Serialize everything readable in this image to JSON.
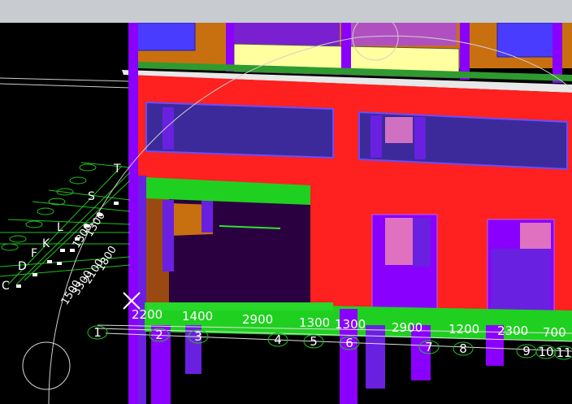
{
  "window": {
    "title": ""
  },
  "viewport": {
    "grid_letters": [
      "T",
      "S",
      "L",
      "K",
      "F",
      "D",
      "C"
    ],
    "grid_numbers": [
      "1",
      "2",
      "3",
      "4",
      "5",
      "6",
      "7",
      "8",
      "9",
      "10",
      "11"
    ],
    "dimensions_front": [
      "2200",
      "1400",
      "2900",
      "1300",
      "1300",
      "2900",
      "1200",
      "2300",
      "700"
    ],
    "dimensions_side_left": [
      "1500",
      "3300",
      "2100",
      "1800"
    ],
    "dimensions_side_right": [
      "1300",
      "1300"
    ],
    "colors": {
      "slab_red": "#ff2020",
      "column_purple": "#8a00ff",
      "window_blue": "#3c2a9a",
      "beam_green": "#20d020",
      "wall_orange": "#c87010",
      "grid_line": "#20c020"
    }
  }
}
